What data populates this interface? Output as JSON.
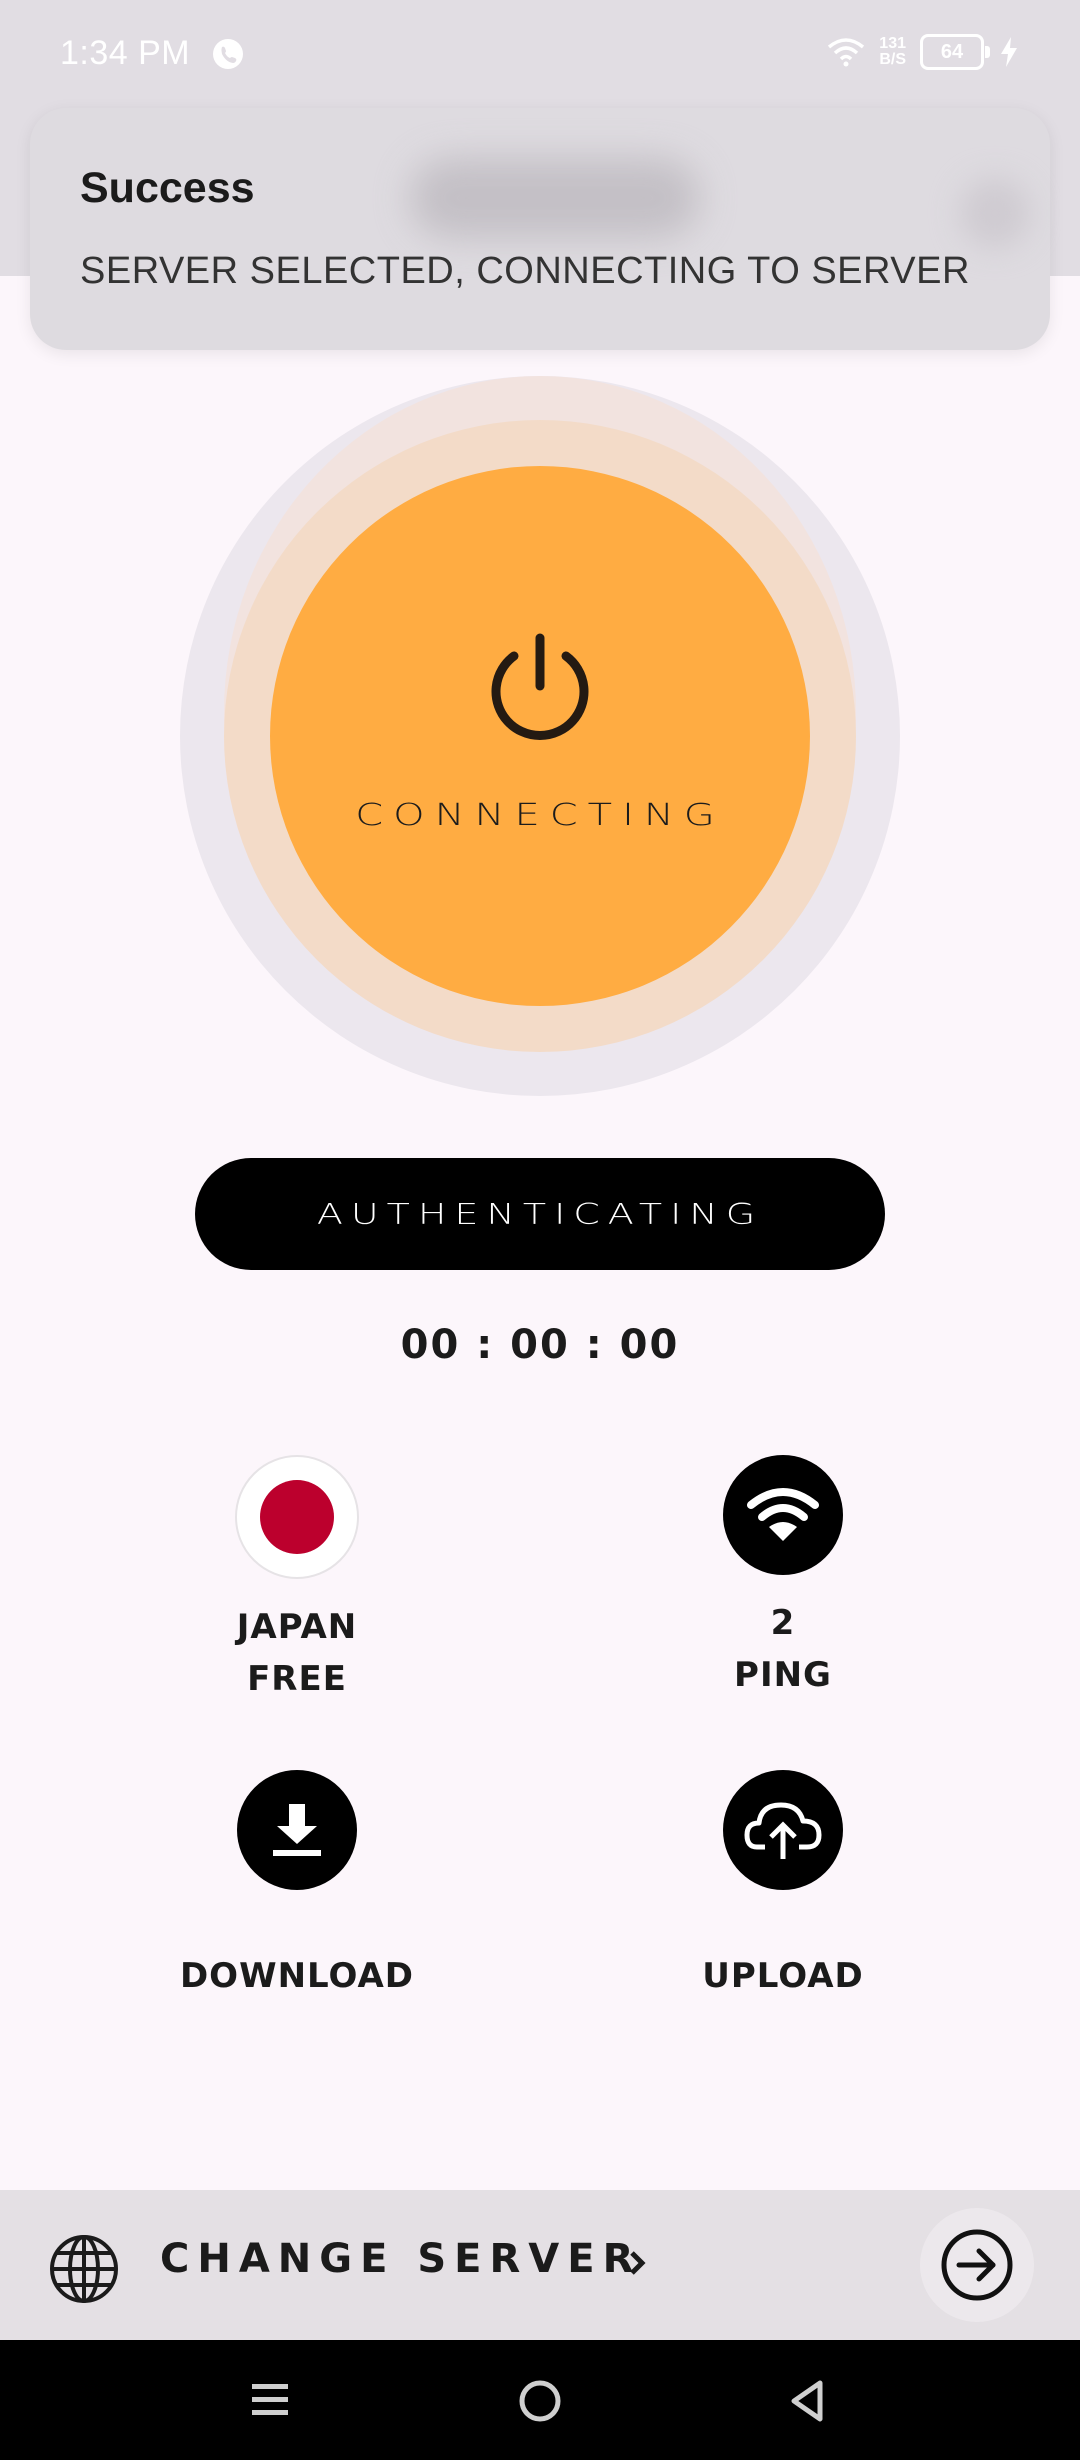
{
  "status_bar": {
    "time": "1:34 PM",
    "net_speed_value": "131",
    "net_speed_unit": "B/S",
    "battery_level": "64"
  },
  "toast": {
    "title": "Success",
    "message": "SERVER SELECTED, CONNECTING TO SERVER"
  },
  "connect_button": {
    "label": "CONNECTING",
    "icon": "power-icon"
  },
  "status_pill": {
    "label": "AUTHENTICATING"
  },
  "timer": {
    "value": "00 : 00 : 00"
  },
  "stats": {
    "location": {
      "icon": "japan-flag-icon",
      "line1": "JAPAN",
      "line2": "FREE"
    },
    "ping": {
      "icon": "wifi-icon",
      "line1": "2",
      "line2": "PING"
    },
    "download": {
      "icon": "download-icon",
      "label": "DOWNLOAD"
    },
    "upload": {
      "icon": "cloud-upload-icon",
      "label": "UPLOAD"
    }
  },
  "bottom_bar": {
    "label": "CHANGE SERVER",
    "globe_icon": "globe-icon",
    "arrow_icon": "arrow-right-circle-icon"
  },
  "colors": {
    "accent_orange": "#ffac42",
    "japan_red": "#bc002d",
    "background": "#fcf6fb"
  }
}
